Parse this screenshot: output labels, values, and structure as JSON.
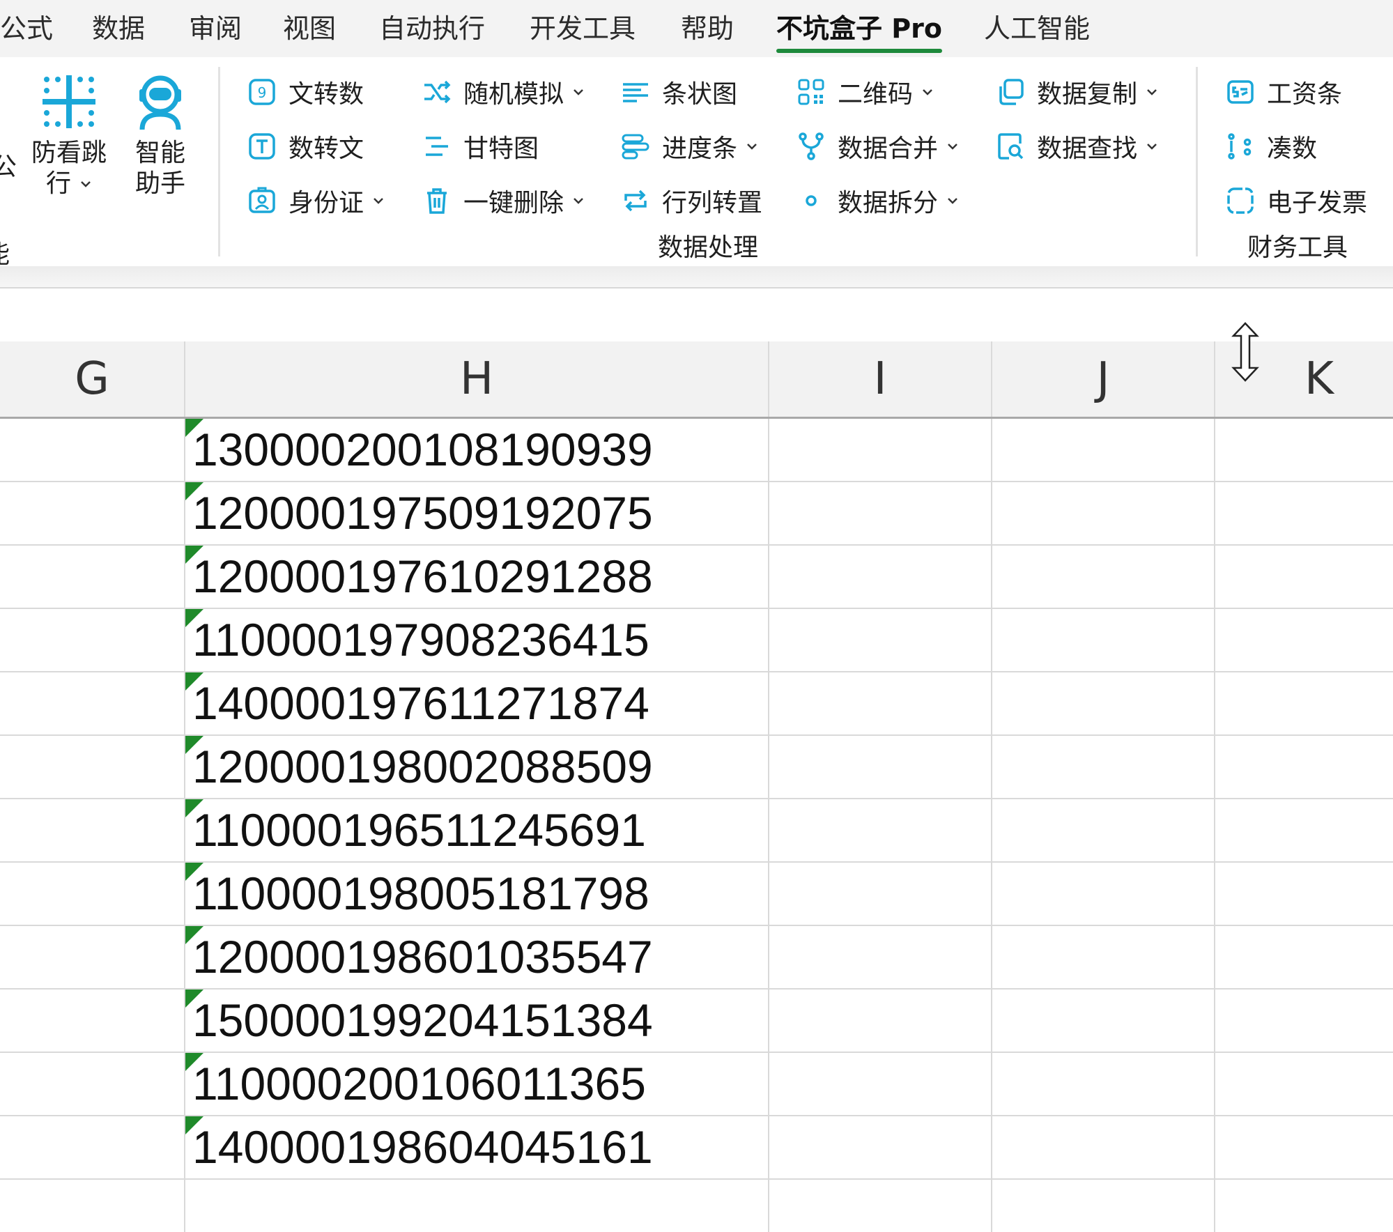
{
  "tabs": [
    {
      "label": "公式"
    },
    {
      "label": "数据"
    },
    {
      "label": "审阅"
    },
    {
      "label": "视图"
    },
    {
      "label": "自动执行"
    },
    {
      "label": "开发工具"
    },
    {
      "label": "帮助"
    },
    {
      "label": "不坑盒子 Pro",
      "active": true
    },
    {
      "label": "人工智能"
    }
  ],
  "ribbon": {
    "left_group": {
      "cut_label_top": "公",
      "cut_label_bottom": "能",
      "anti_skip": {
        "line1": "防看跳",
        "line2": "行",
        "icon": "grid-dots-icon"
      },
      "assistant": {
        "line1": "智能",
        "line2": "助手",
        "icon": "robot-icon"
      }
    },
    "data_processing": {
      "label": "数据处理",
      "buttons": {
        "text_to_num": "文转数",
        "num_to_text": "数转文",
        "id_card": "身份证",
        "random_sim": "随机模拟",
        "gantt": "甘特图",
        "one_click_delete": "一键删除",
        "bar_chart": "条状图",
        "progress_bar": "进度条",
        "transpose": "行列转置",
        "qr_code": "二维码",
        "data_merge": "数据合并",
        "data_split": "数据拆分",
        "data_copy": "数据复制",
        "data_lookup": "数据查找"
      }
    },
    "finance_tools": {
      "label": "财务工具",
      "buttons": {
        "payslip": "工资条",
        "make_up_sum": "凑数",
        "e_invoice": "电子发票"
      }
    },
    "accent_color": "#1aa7d8"
  },
  "sheet": {
    "columns": [
      "G",
      "H",
      "I",
      "J",
      "K"
    ],
    "h_values": [
      "130000200108190939",
      "120000197509192075",
      "120000197610291288",
      "110000197908236415",
      "140000197611271874",
      "120000198002088509",
      "110000196511245691",
      "110000198005181798",
      "120000198601035547",
      "150000199204151384",
      "110000200106011365",
      "140000198604045161"
    ],
    "error_indicator_color": "#1f8a2a"
  }
}
